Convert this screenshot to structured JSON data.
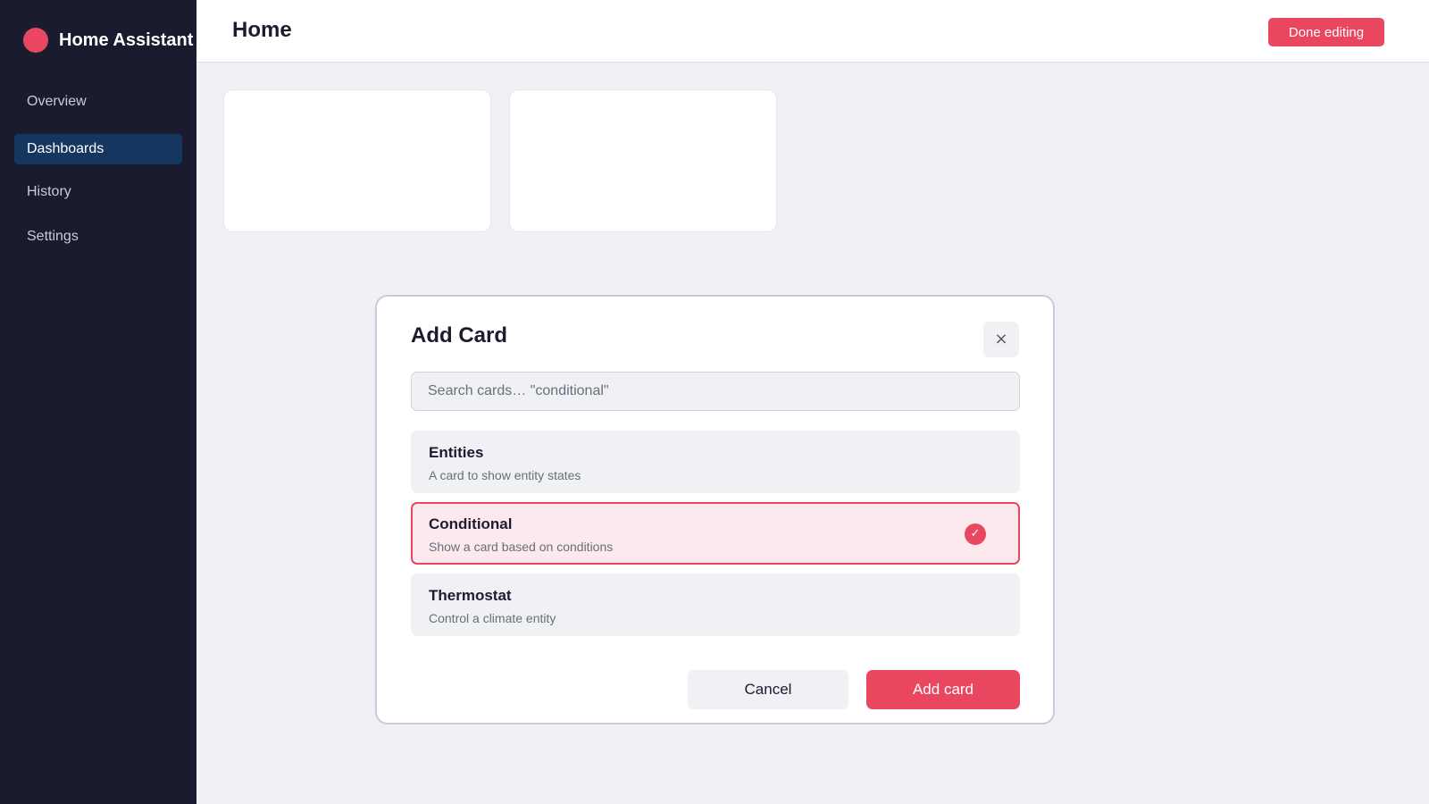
{
  "app": {
    "brand_name": "Home Assistant",
    "brand_icon": "home-assistant-logo",
    "accent_color": "#e8475f",
    "sidebar_color": "#1b1b30"
  },
  "sidebar": {
    "items": [
      {
        "label": "Overview",
        "active": false
      },
      {
        "label": "Dashboards",
        "active": true
      },
      {
        "label": "History",
        "active": false
      },
      {
        "label": "Settings",
        "active": false
      }
    ]
  },
  "header": {
    "title": "Home",
    "done_label": "Done editing"
  },
  "modal": {
    "title": "Add Card",
    "close_icon": "×",
    "search": {
      "placeholder": "Search cards… \"conditional\"",
      "value": ""
    },
    "options": [
      {
        "name": "Entities",
        "description": "A card to show entity states",
        "selected": false
      },
      {
        "name": "Conditional",
        "description": "Show a card based on conditions",
        "selected": true
      },
      {
        "name": "Thermostat",
        "description": "Control a climate entity",
        "selected": false
      }
    ],
    "selected_icon": "✓",
    "cancel_label": "Cancel",
    "add_label": "Add card"
  }
}
